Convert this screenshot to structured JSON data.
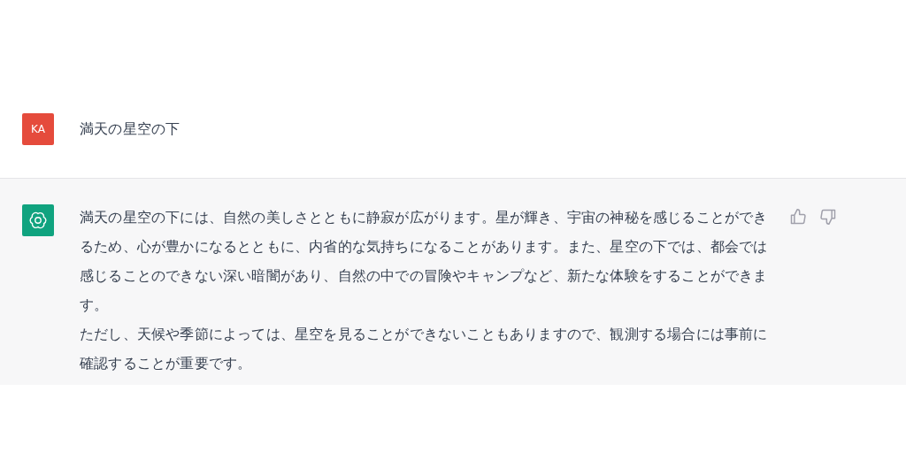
{
  "messages": [
    {
      "kind": "user",
      "avatar": "KA",
      "paragraphs": [
        "満天の星空の下"
      ]
    },
    {
      "kind": "assistant",
      "paragraphs": [
        "満天の星空の下には、自然の美しさとともに静寂が広がります。星が輝き、宇宙の神秘を感じることができるため、心が豊かになるとともに、内省的な気持ちになることがあります。また、星空の下では、都会では感じることのできない深い暗闇があり、自然の中での冒険やキャンプなど、新たな体験をすることができます。",
        "ただし、天候や季節によっては、星空を見ることができないこともありますので、観測する場合には事前に確認することが重要です。"
      ]
    }
  ]
}
